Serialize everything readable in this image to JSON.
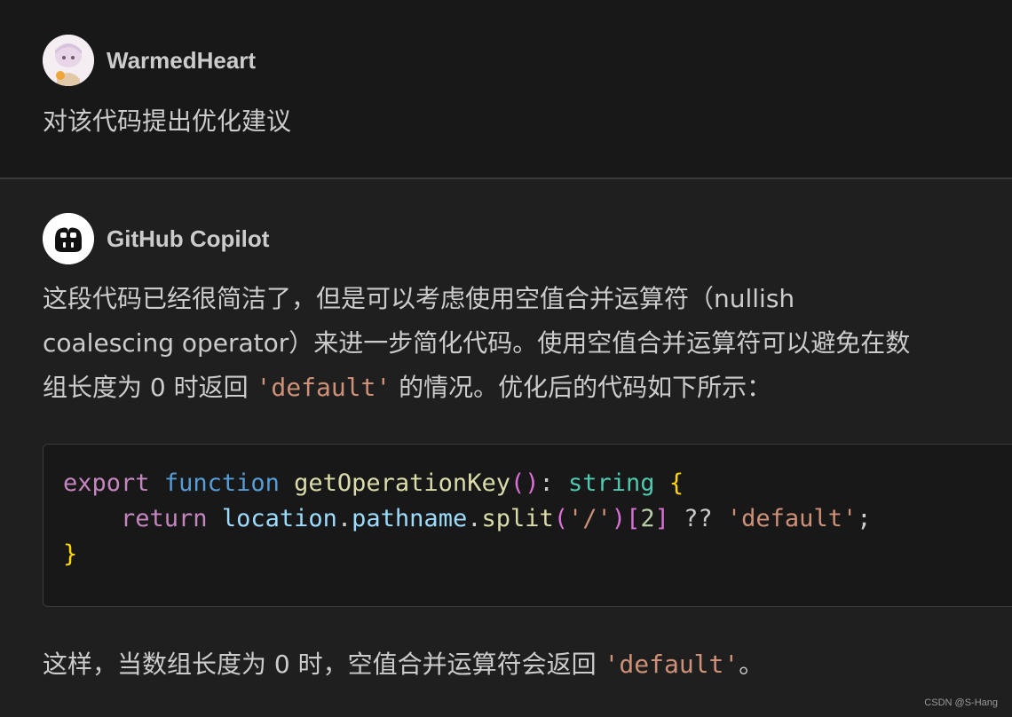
{
  "user": {
    "name": "WarmedHeart",
    "message": "对该代码提出优化建议"
  },
  "assistant": {
    "name": "GitHub Copilot",
    "intro_line1": "这段代码已经很简洁了，但是可以考虑使用空值合并运算符（nullish",
    "intro_line2": "coalescing operator）来进一步简化代码。使用空值合并运算符可以避免在数",
    "intro_line3_pre": "组长度为 0 时返回 ",
    "intro_line3_code": "'default'",
    "intro_line3_post": " 的情况。优化后的代码如下所示：",
    "outro_pre": "这样，当数组长度为 0 时，空值合并运算符会返回 ",
    "outro_code": "'default'",
    "outro_post": "。"
  },
  "code": {
    "l1_export": "export",
    "l1_function": "function",
    "l1_name": "getOperationKey",
    "l1_parens": "()",
    "l1_colon": ":",
    "l1_type": "string",
    "l1_brace": "{",
    "l2_return": "return",
    "l2_location": "location",
    "l2_dot1": ".",
    "l2_pathname": "pathname",
    "l2_dot2": ".",
    "l2_split": "split",
    "l2_open": "(",
    "l2_arg": "'/'",
    "l2_close": ")",
    "l2_bopen": "[",
    "l2_index": "2",
    "l2_bclose": "]",
    "l2_nullish": "??",
    "l2_default": "'default'",
    "l2_semi": ";",
    "l3_brace": "}"
  },
  "watermark": "CSDN @S-Hang",
  "colors": {
    "keyword_pink": "#c586c0",
    "keyword_blue": "#569cd6",
    "function": "#dcdcaa",
    "type": "#4ec9b0",
    "string": "#ce9178",
    "brace": "#ffd700"
  },
  "icons": {
    "user_avatar": "avatar-image",
    "copilot_avatar": "copilot-icon"
  }
}
